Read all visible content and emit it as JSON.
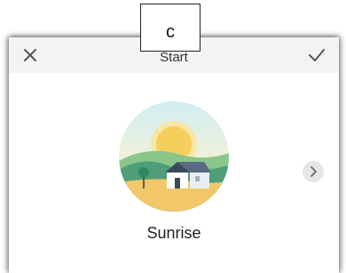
{
  "annotation": {
    "label": "c"
  },
  "dialog": {
    "title": "Start",
    "close_icon": "close-icon",
    "confirm_icon": "check-icon"
  },
  "theme": {
    "name": "Sunrise",
    "illustration": "sunrise-landscape-illustration",
    "next_icon": "chevron-right-icon"
  },
  "colors": {
    "header_bg": "#f3f3f3",
    "sky_top": "#d6eef2",
    "sun": "#f7d36b",
    "hill_dark": "#4f9e7a",
    "hill_light": "#8cc58a",
    "ground": "#f2c76a"
  }
}
